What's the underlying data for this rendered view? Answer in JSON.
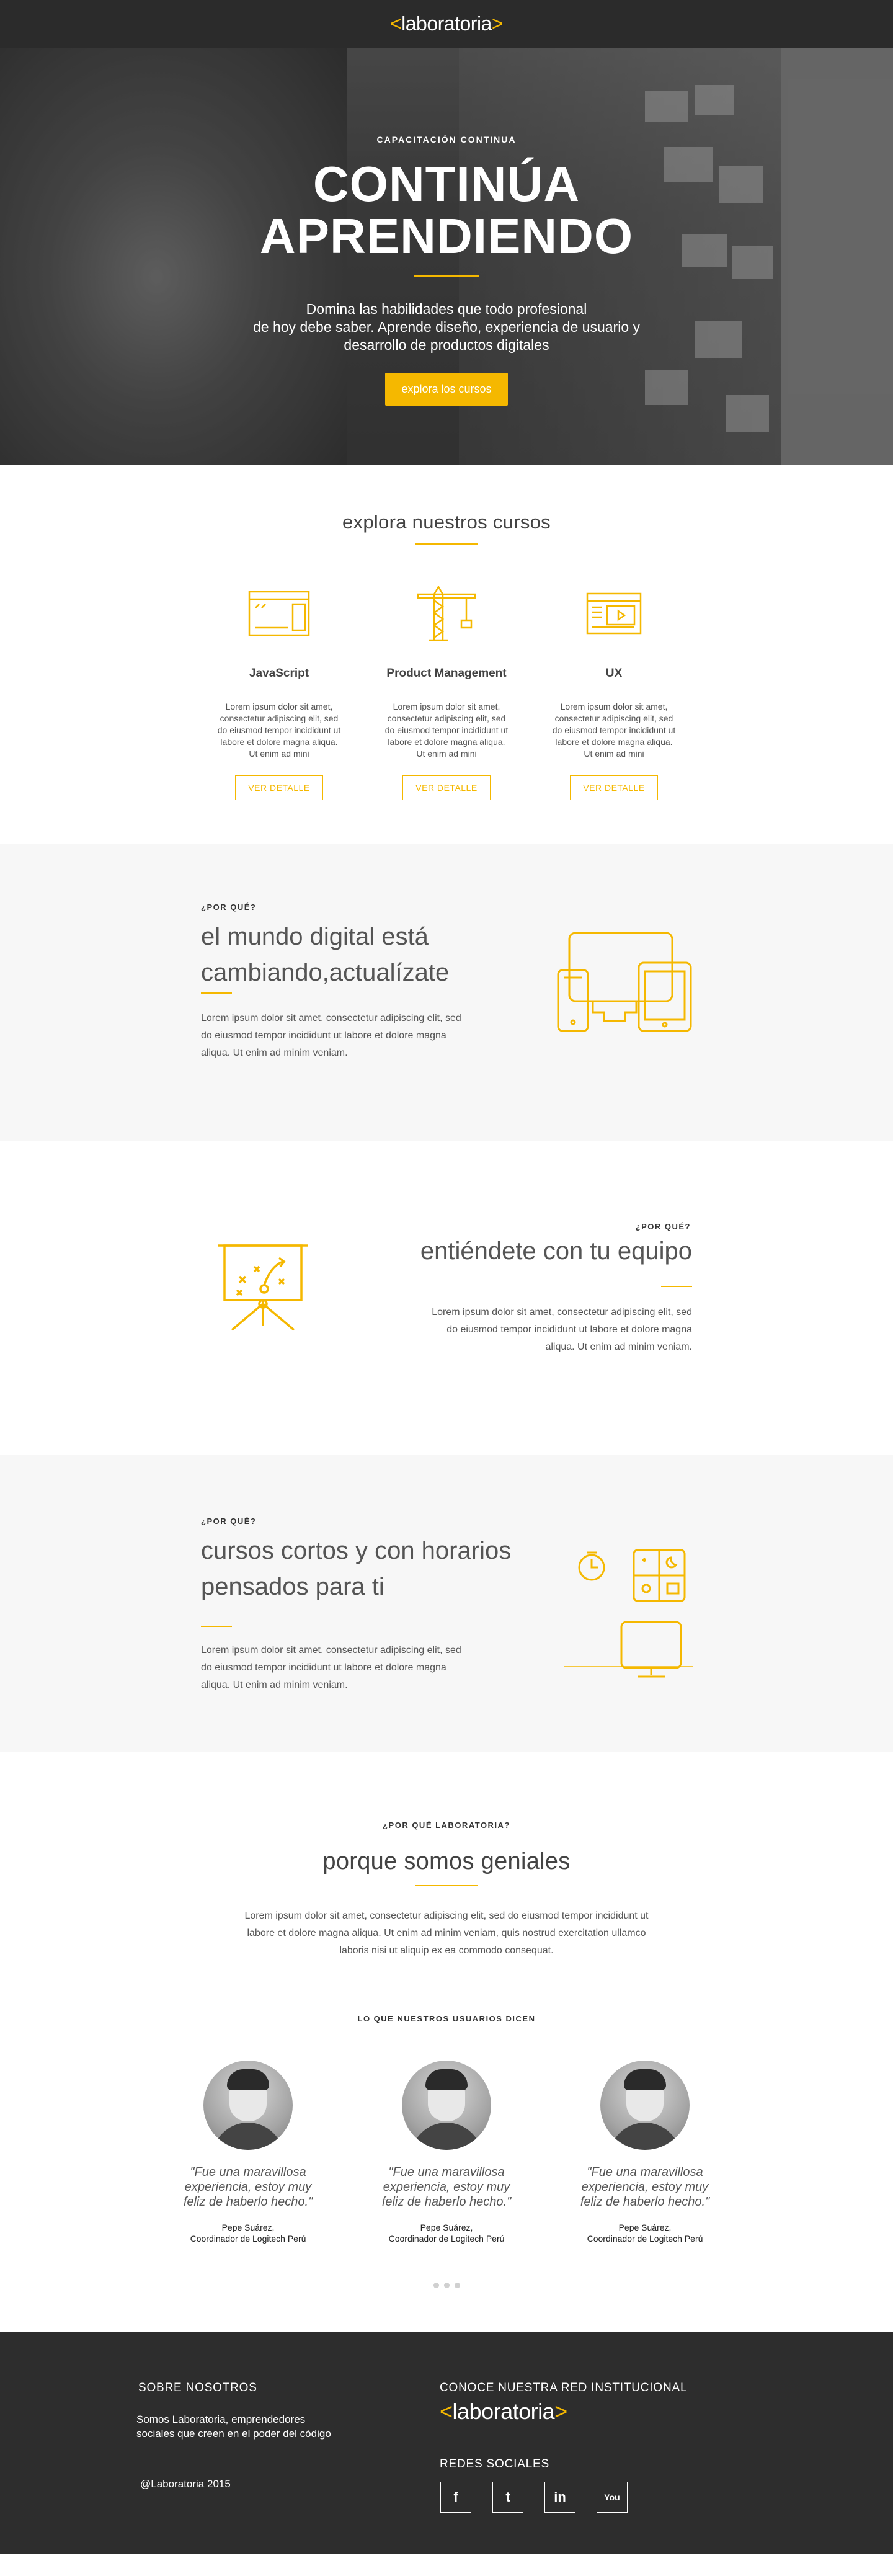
{
  "header": {
    "logo_left": "<",
    "logo_text": "laboratoria",
    "logo_right": ">"
  },
  "hero": {
    "eyebrow": "CAPACITACIÓN CONTINUA",
    "title_line1": "CONTINÚA",
    "title_line2": "APRENDIENDO",
    "subtitle_line1": "Domina las habilidades que todo profesional",
    "subtitle_line2": "de hoy debe saber. Aprende diseño, experiencia de usuario y",
    "subtitle_line3": "desarrollo de productos digitales",
    "cta": "explora los cursos"
  },
  "courses": {
    "title": "explora nuestros cursos",
    "items": [
      {
        "icon": "code-window-icon",
        "name": "JavaScript",
        "desc": "Lorem ipsum dolor sit amet, consectetur adipiscing elit, sed do eiusmod tempor incididunt ut labore et dolore magna aliqua. Ut enim ad mini",
        "button": "VER DETALLE"
      },
      {
        "icon": "crane-icon",
        "name": "Product Management",
        "desc": "Lorem ipsum dolor sit amet, consectetur adipiscing elit, sed do eiusmod tempor incididunt ut labore et dolore magna aliqua. Ut enim ad mini",
        "button": "VER DETALLE"
      },
      {
        "icon": "media-browser-icon",
        "name": "UX",
        "desc": "Lorem ipsum dolor sit amet, consectetur adipiscing elit, sed do eiusmod tempor incididunt ut labore et dolore magna aliqua. Ut enim ad mini",
        "button": "VER DETALLE"
      }
    ]
  },
  "feature1": {
    "eyebrow": "¿POR QUÉ?",
    "title_line1": "el mundo digital está",
    "title_line2": "cambiando,actualízate",
    "text_line1": "Lorem ipsum dolor sit amet, consectetur adipiscing elit, sed",
    "text_line2": "do eiusmod tempor incididunt ut labore et dolore magna",
    "text_line3": "aliqua. Ut enim ad minim veniam."
  },
  "feature2": {
    "eyebrow": "¿POR QUÉ?",
    "title": "entiéndete con tu equipo",
    "text_line1": "Lorem ipsum dolor sit amet, consectetur adipiscing elit, sed",
    "text_line2": "do eiusmod tempor incididunt ut labore et dolore magna",
    "text_line3": "aliqua. Ut enim ad minim veniam."
  },
  "feature3": {
    "eyebrow": "¿POR QUÉ?",
    "title_line1": "cursos cortos y con horarios",
    "title_line2": "pensados para ti",
    "text_line1": "Lorem ipsum dolor sit amet, consectetur adipiscing elit, sed",
    "text_line2": "do eiusmod tempor incididunt ut labore et dolore magna",
    "text_line3": "aliqua. Ut enim ad minim veniam."
  },
  "why": {
    "eyebrow": "¿POR QUÉ LABORATORIA?",
    "title": "porque somos geniales",
    "text_line1": "Lorem ipsum dolor sit amet, consectetur adipiscing elit, sed do eiusmod tempor incididunt ut",
    "text_line2": "labore et dolore magna aliqua. Ut enim ad minim veniam, quis nostrud exercitation ullamco",
    "text_line3": "laboris nisi ut aliquip ex ea commodo consequat."
  },
  "testimonials": {
    "heading": "LO QUE NUESTROS USUARIOS DICEN",
    "items": [
      {
        "quote": "\"Fue una maravillosa experiencia, estoy muy feliz de haberlo hecho.\"",
        "name": "Pepe Suárez,",
        "role": "Coordinador de Logitech Perú"
      },
      {
        "quote": "\"Fue una maravillosa experiencia, estoy muy feliz de haberlo hecho.\"",
        "name": "Pepe Suárez,",
        "role": "Coordinador de Logitech Perú"
      },
      {
        "quote": "\"Fue una maravillosa experiencia, estoy muy feliz de haberlo hecho.\"",
        "name": "Pepe Suárez,",
        "role": "Coordinador de Logitech Perú"
      }
    ]
  },
  "footer": {
    "about_title": "SOBRE NOSOTROS",
    "about_line1": "Somos Laboratoria, emprendedores",
    "about_line2": "sociales que creen en el poder del código",
    "copyright": "@Laboratoria 2015",
    "network_title": "CONOCE NUESTRA RED INSTITUCIONAL",
    "social_title": "REDES SOCIALES",
    "social": [
      {
        "icon": "facebook-icon",
        "glyph": "f"
      },
      {
        "icon": "twitter-icon",
        "glyph": "t"
      },
      {
        "icon": "linkedin-icon",
        "glyph": "in"
      },
      {
        "icon": "youtube-icon",
        "glyph": "You"
      }
    ]
  },
  "colors": {
    "accent": "#f5b800",
    "dark": "#2b2b2b",
    "gray_bg": "#f7f7f7"
  }
}
